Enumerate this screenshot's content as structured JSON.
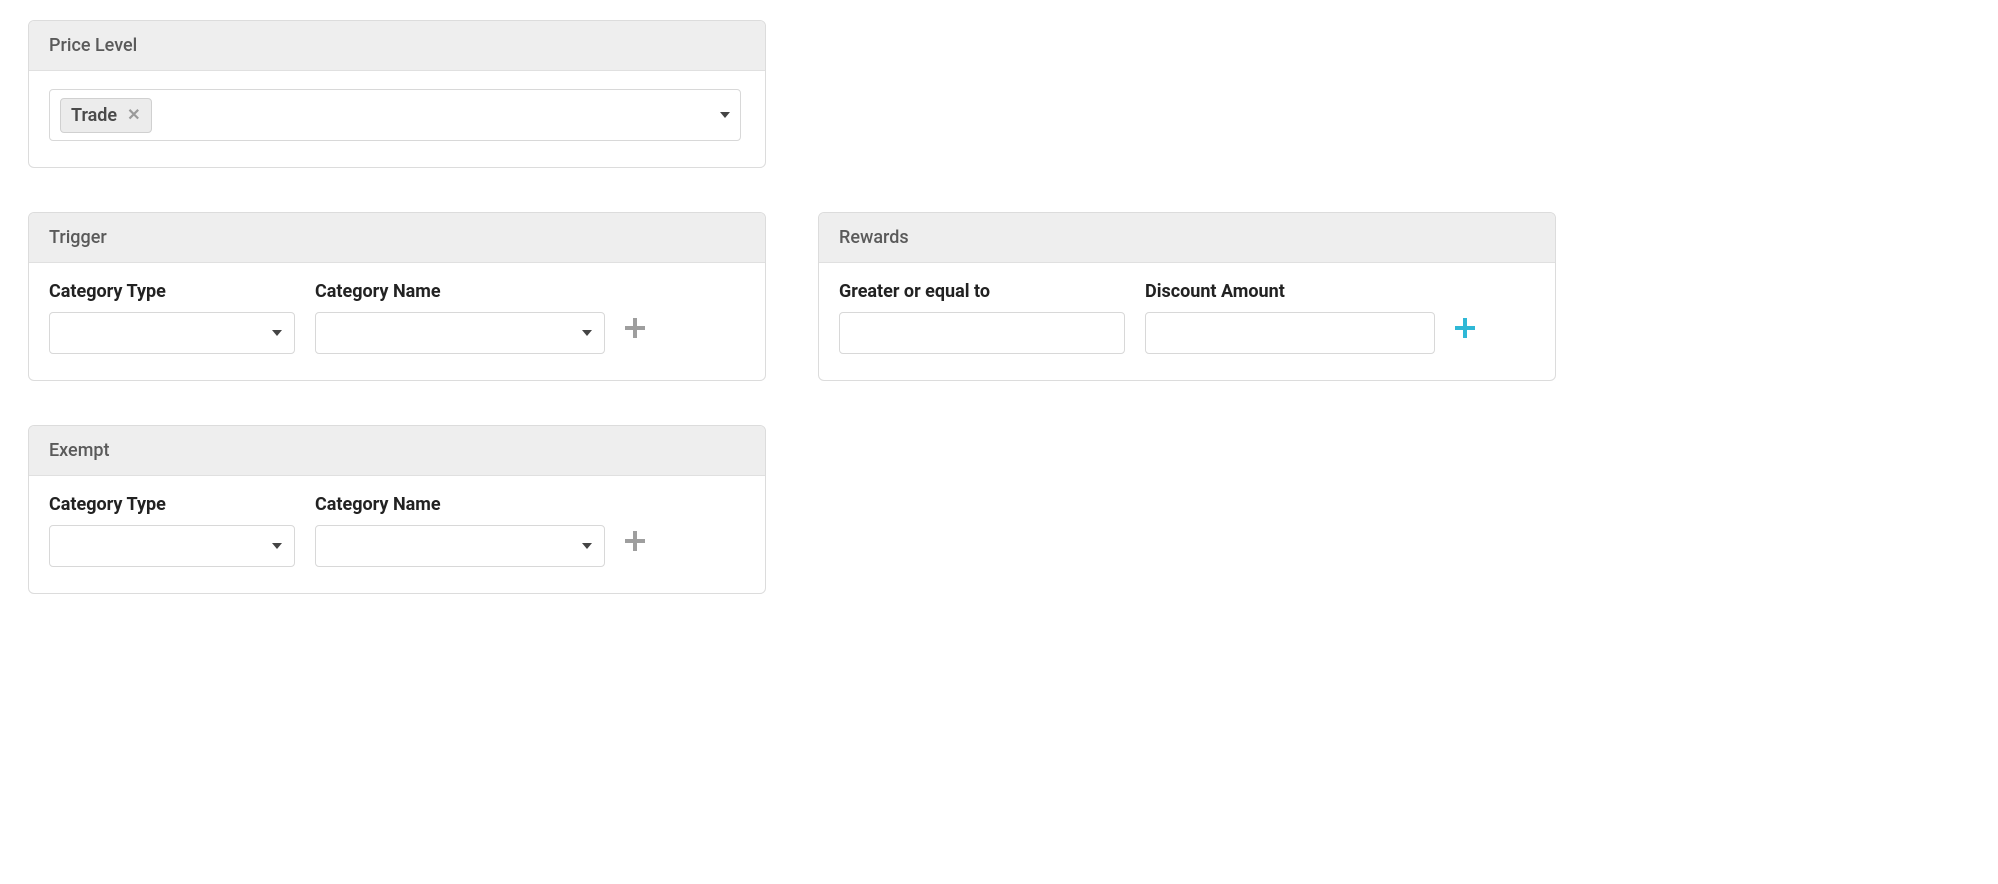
{
  "panels": {
    "price_level": {
      "title": "Price Level",
      "selected": [
        "Trade"
      ]
    },
    "trigger": {
      "title": "Trigger",
      "category_type_label": "Category Type",
      "category_name_label": "Category Name",
      "category_type_value": "",
      "category_name_value": ""
    },
    "rewards": {
      "title": "Rewards",
      "gte_label": "Greater or equal to",
      "discount_label": "Discount Amount",
      "gte_value": "",
      "discount_value": ""
    },
    "exempt": {
      "title": "Exempt",
      "category_type_label": "Category Type",
      "category_name_label": "Category Name",
      "category_type_value": "",
      "category_name_value": ""
    }
  },
  "icons": {
    "plus": "plus-icon",
    "caret": "caret-down-icon",
    "remove": "close-icon"
  },
  "colors": {
    "accent": "#2fb8d6",
    "panel_header_bg": "#eeeeee",
    "border": "#d8d8d8"
  }
}
